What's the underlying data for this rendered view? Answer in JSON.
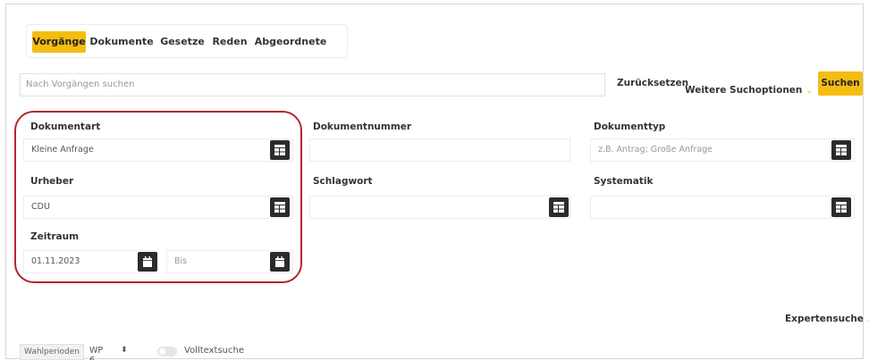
{
  "tabs": [
    {
      "label": "Vorgänge",
      "active": true
    },
    {
      "label": "Dokumente",
      "active": false
    },
    {
      "label": "Gesetze",
      "active": false
    },
    {
      "label": "Reden",
      "active": false
    },
    {
      "label": "Abgeordnete",
      "active": false
    }
  ],
  "search": {
    "placeholder": "Nach Vorgängen suchen",
    "reset_label": "Zurücksetzen",
    "more_options_label": "Weitere Suchoptionen",
    "submit_label": "Suchen"
  },
  "filters": {
    "dokumentart": {
      "label": "Dokumentart",
      "value": "Kleine Anfrage"
    },
    "urheber": {
      "label": "Urheber",
      "value": "CDU"
    },
    "zeitraum": {
      "label": "Zeitraum",
      "from": "01.11.2023",
      "to_placeholder": "Bis"
    },
    "dokumentnummer": {
      "label": "Dokumentnummer",
      "value": ""
    },
    "schlagwort": {
      "label": "Schlagwort",
      "value": ""
    },
    "dokumenttyp": {
      "label": "Dokumenttyp",
      "placeholder": "z.B. Antrag; Große Anfrage"
    },
    "systematik": {
      "label": "Systematik",
      "value": ""
    }
  },
  "expert_search_label": "Expertensuche",
  "footer": {
    "wahlperioden_label": "Wahlperioden",
    "wp_value": "WP 6",
    "volltext_label": "Volltextsuche"
  },
  "colors": {
    "accent": "#f4bd12",
    "highlight": "#b3272d",
    "icon_button": "#2b2b2b"
  }
}
